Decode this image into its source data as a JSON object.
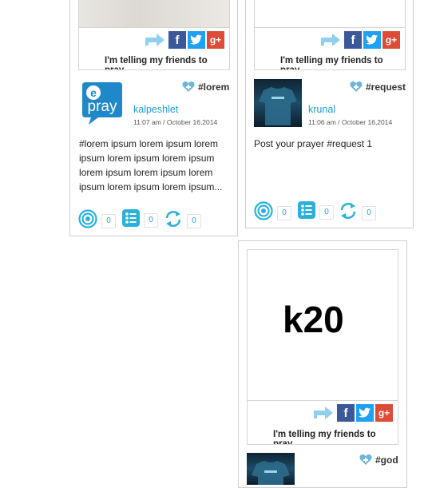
{
  "posts": [
    {
      "username": "kalpeshlet",
      "timestamp": "11:07 am / October 16,2014",
      "tag": "#lorem",
      "body": "#lorem ipsum lorem ipsum lorem ipsum lorem ipsum lorem ipsum lorem ipsum lorem ipsum lorem ipsum lorem ipsum lorem ipsum...",
      "pray_count": "0",
      "list_count": "0",
      "share_count": "0",
      "avatar_text": "pray"
    },
    {
      "username": "krunal",
      "timestamp": "11:06 am / October 16,2014",
      "tag": "#request",
      "body": "Post your prayer #request 1",
      "pray_count": "0",
      "list_count": "0",
      "share_count": "0"
    },
    {
      "image_text": "k20",
      "tag": "#god"
    }
  ],
  "share": {
    "telling": "I'm telling my friends to pray",
    "facebook_letter": "f",
    "google_label": "g+"
  },
  "colors": {
    "accent": "#1a9fd1",
    "facebook": "#3b5998",
    "twitter": "#1da1f2",
    "google": "#dd4b39",
    "heart": "#6fb6d6"
  },
  "icons": [
    "forward-share-icon",
    "facebook-icon",
    "twitter-icon",
    "google-plus-icon",
    "heart-plus-icon",
    "pray-target-icon",
    "list-icon",
    "refresh-icon"
  ]
}
